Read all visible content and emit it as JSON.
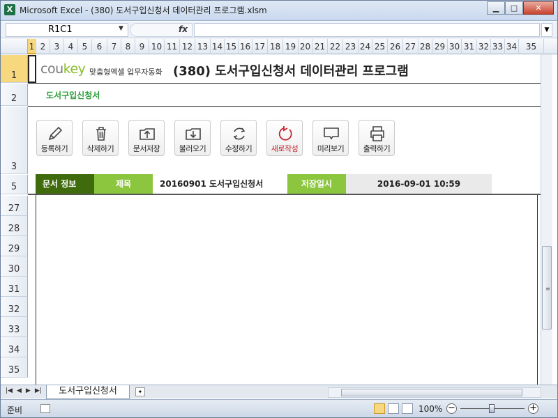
{
  "window": {
    "title": "Microsoft Excel - (380) 도서구입신청서 데이터관리 프로그램.xlsm",
    "app_icon": "X",
    "minimize_glyph": "▁",
    "maximize_glyph": "□",
    "close_glyph": "✕"
  },
  "formula_bar": {
    "name_box": "R1C1",
    "fx": "fx",
    "formula": ""
  },
  "columns": [
    "1",
    "2",
    "3",
    "4",
    "5",
    "6",
    "7",
    "8",
    "9",
    "10",
    "11",
    "12",
    "13",
    "14",
    "15",
    "16",
    "17",
    "18",
    "19",
    "20",
    "21",
    "22",
    "23",
    "24",
    "25",
    "26",
    "27",
    "28",
    "29",
    "30",
    "31",
    "32",
    "33",
    "34",
    "35"
  ],
  "rows_top": [
    "1",
    "2",
    "3",
    "5"
  ],
  "rows_body": [
    "27",
    "28",
    "29",
    "30",
    "31",
    "32",
    "33",
    "34",
    "35"
  ],
  "header": {
    "brand_cou": "cou",
    "brand_key": "key",
    "brand_sub": "맞춤형엑셀 업무자동화",
    "title": "(380) 도서구입신청서 데이터관리 프로그램",
    "subtitle": "도서구입신청서"
  },
  "toolbar": [
    {
      "label": "등록하기",
      "icon": "pencil-icon"
    },
    {
      "label": "삭제하기",
      "icon": "trash-icon"
    },
    {
      "label": "문서저장",
      "icon": "upload-folder-icon"
    },
    {
      "label": "불러오기",
      "icon": "download-folder-icon"
    },
    {
      "label": "수정하기",
      "icon": "refresh-icon"
    },
    {
      "label": "새로작성",
      "icon": "new-document-icon"
    },
    {
      "label": "미리보기",
      "icon": "monitor-icon"
    },
    {
      "label": "출력하기",
      "icon": "printer-icon"
    }
  ],
  "info": {
    "section_label": "문서 정보",
    "title_label": "제목",
    "title_value": "20160901 도서구입신청서",
    "saved_label": "저장일시",
    "saved_value": "2016-09-01 10:59"
  },
  "sheet_tabs": {
    "active": "도서구입신청서"
  },
  "status": {
    "ready": "준비",
    "zoom": "100%",
    "minus": "−",
    "plus": "+"
  },
  "colors": {
    "accent_green": "#8cc63f",
    "dark_green": "#3f6b0d",
    "subtitle_green": "#2e9e3a",
    "selection_yellow": "#f8d87f"
  }
}
